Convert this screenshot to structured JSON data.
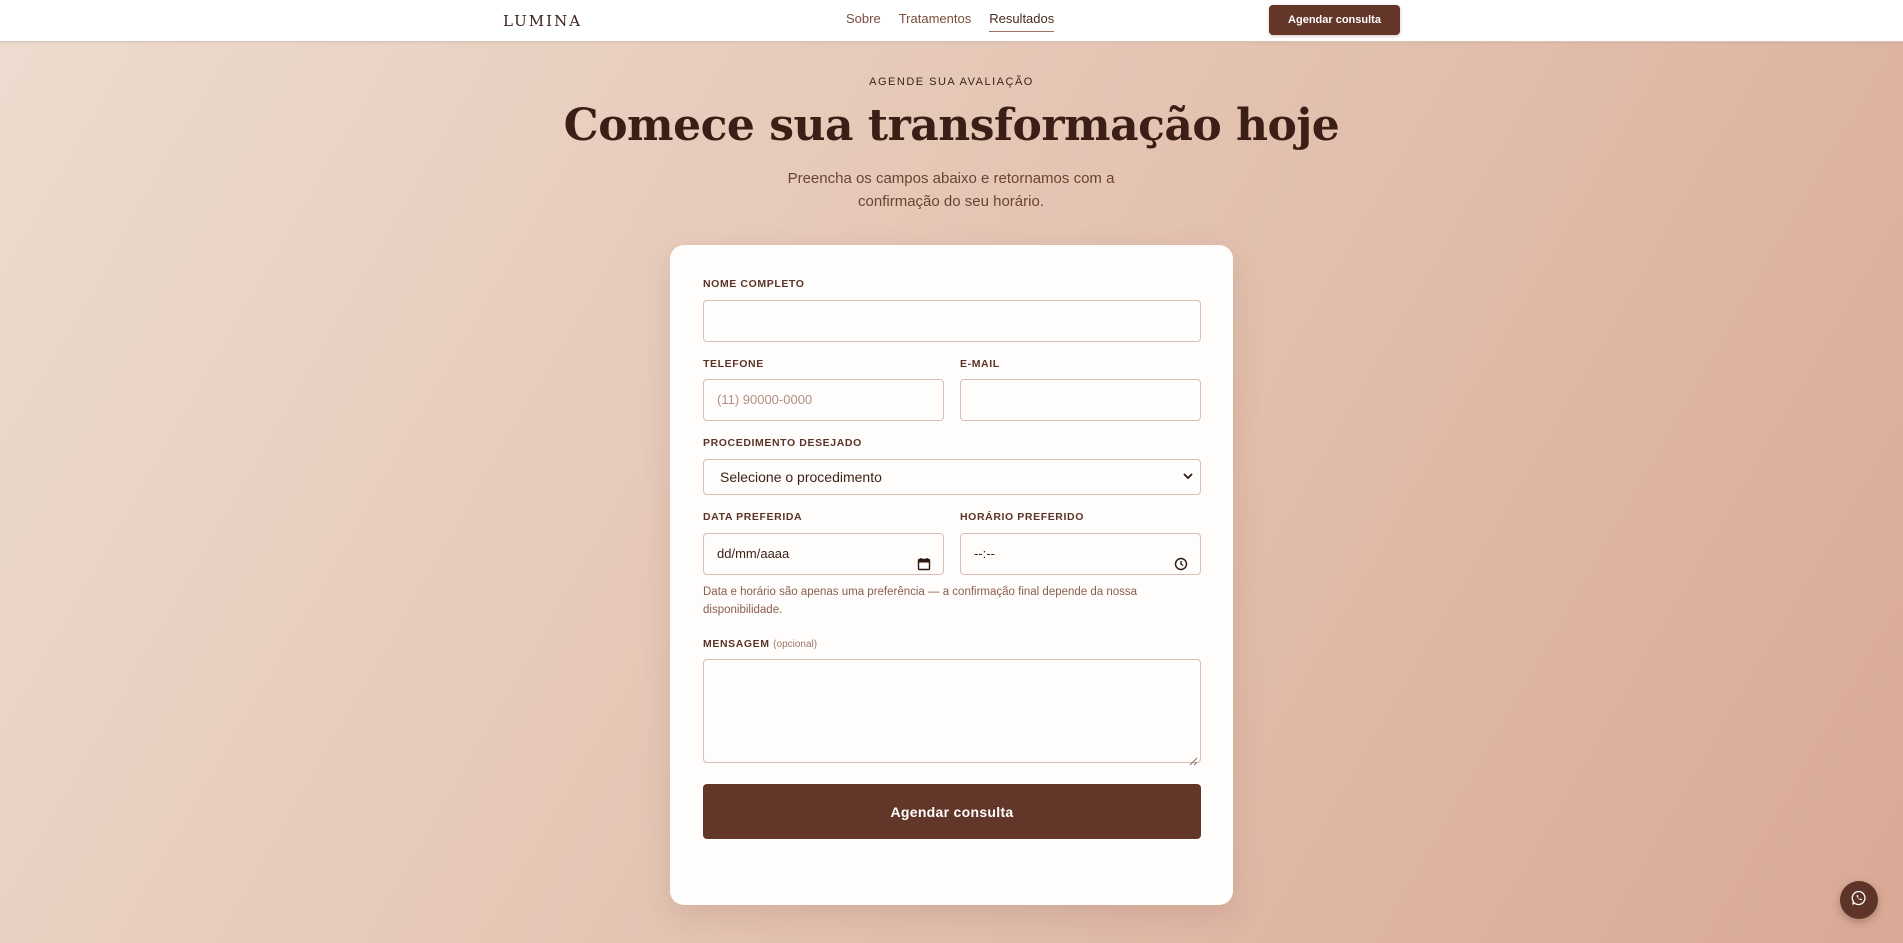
{
  "header": {
    "logo": "LUMINA",
    "nav": [
      {
        "label": "Sobre"
      },
      {
        "label": "Tratamentos"
      },
      {
        "label": "Resultados",
        "active": true
      }
    ],
    "cta_label": "Agendar consulta"
  },
  "hero": {
    "eyebrow": "AGENDE SUA AVALIAÇÃO",
    "headline": "Comece sua transformação hoje",
    "subtitle": "Preencha os campos abaixo e retornamos com a confirmação do seu horário."
  },
  "form": {
    "name": {
      "label": "NOME COMPLETO",
      "value": ""
    },
    "phone": {
      "label": "TELEFONE",
      "placeholder": "(11) 90000-0000",
      "value": ""
    },
    "email": {
      "label": "E-MAIL",
      "value": ""
    },
    "procedure": {
      "label": "PROCEDIMENTO DESEJADO",
      "selected": "Selecione o procedimento"
    },
    "date": {
      "label": "DATA PREFERIDA",
      "value": "dd/mm/aaaa"
    },
    "time": {
      "label": "HORÁRIO PREFERIDO",
      "value": "--:--"
    },
    "hint": "Data e horário são apenas uma preferência — a confirmação final depende da nossa disponibilidade.",
    "message": {
      "label": "MENSAGEM",
      "optional": "(opcional)",
      "value": ""
    },
    "submit_label": "Agendar consulta"
  },
  "icons": {
    "select": "chevron-down-icon",
    "date": "calendar-icon",
    "time": "clock-icon",
    "fab": "whatsapp-icon"
  },
  "colors": {
    "brand": "#64362a",
    "text": "#3d2218",
    "border": "#d8bdb0"
  }
}
